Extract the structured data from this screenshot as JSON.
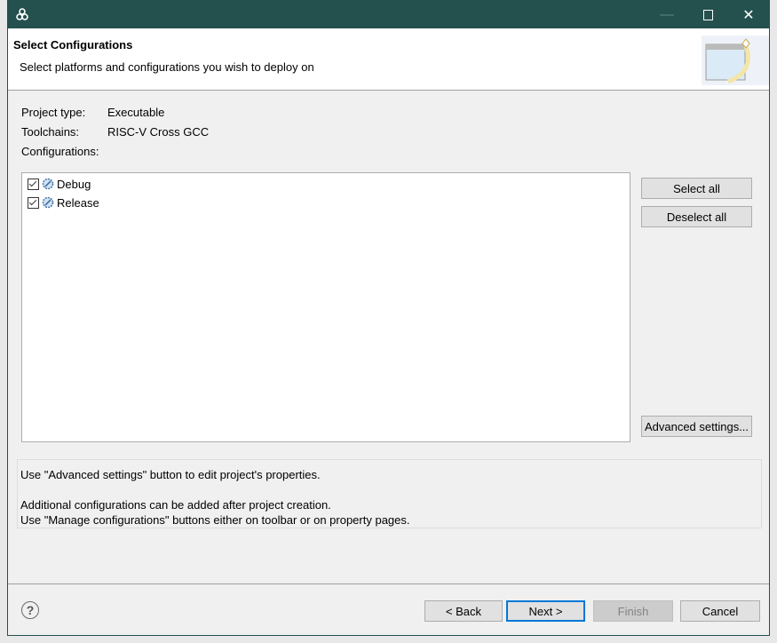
{
  "window": {
    "minimize_icon": "minimize-icon",
    "maximize_icon": "maximize-icon",
    "close_icon": "close-icon",
    "title_bar_color": "#24504e"
  },
  "header": {
    "title": "Select Configurations",
    "subtitle": "Select platforms and configurations you wish to deploy on"
  },
  "info": {
    "project_type_label": "Project type:",
    "project_type_value": "Executable",
    "toolchains_label": "Toolchains:",
    "toolchains_value": "RISC-V Cross GCC",
    "configurations_label": "Configurations:"
  },
  "configurations": [
    {
      "label": "Debug",
      "checked": true
    },
    {
      "label": "Release",
      "checked": true
    }
  ],
  "side_buttons": {
    "select_all": "Select all",
    "deselect_all": "Deselect all",
    "advanced": "Advanced settings..."
  },
  "notes": {
    "line1": "Use \"Advanced settings\" button to edit project's properties.",
    "line2": "Additional configurations can be added after project creation.",
    "line3": "Use \"Manage configurations\" buttons either on toolbar or on property pages."
  },
  "footer": {
    "back": "< Back",
    "next": "Next >",
    "finish": "Finish",
    "cancel": "Cancel",
    "accent": "#0078d7"
  }
}
